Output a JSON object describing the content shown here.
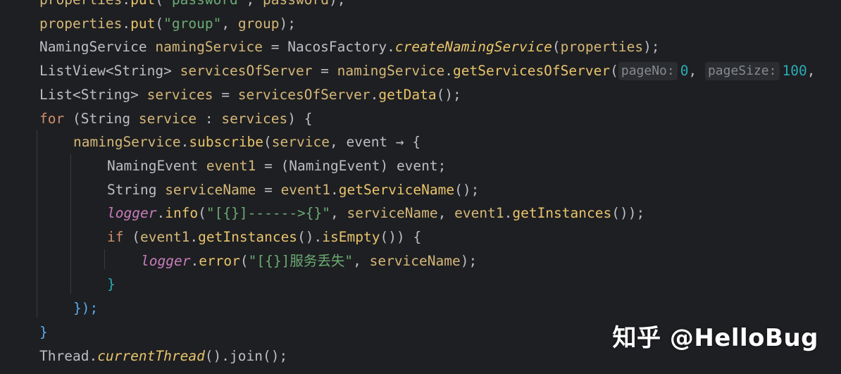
{
  "colors": {
    "background": "#1e1f22",
    "plain": "#bcbec4",
    "method": "#57aaf7",
    "field": "#c77dbb",
    "local": "#d5b778",
    "string": "#6aab73",
    "keyword": "#cf8e6d",
    "static": "#e8c46c",
    "number": "#2aacb8",
    "hint": "#868a91"
  },
  "code_lines": [
    {
      "tokens": [
        {
          "t": "properties",
          "c": "local"
        },
        {
          "t": ".",
          "c": "plain"
        },
        {
          "t": "put",
          "c": "static"
        },
        {
          "t": "(",
          "c": "plain"
        },
        {
          "t": "\"password\"",
          "c": "string"
        },
        {
          "t": ", ",
          "c": "plain"
        },
        {
          "t": "password",
          "c": "local"
        },
        {
          "t": ");",
          "c": "plain"
        }
      ]
    },
    {
      "tokens": [
        {
          "t": "properties",
          "c": "local"
        },
        {
          "t": ".",
          "c": "plain"
        },
        {
          "t": "put",
          "c": "static"
        },
        {
          "t": "(",
          "c": "plain"
        },
        {
          "t": "\"group\"",
          "c": "string"
        },
        {
          "t": ", ",
          "c": "plain"
        },
        {
          "t": "group",
          "c": "local"
        },
        {
          "t": ");",
          "c": "plain"
        }
      ]
    },
    {
      "tokens": [
        {
          "t": "NamingService ",
          "c": "plain"
        },
        {
          "t": "namingService",
          "c": "local"
        },
        {
          "t": " = NacosFactory.",
          "c": "plain"
        },
        {
          "t": "createNamingService",
          "c": "static_italic"
        },
        {
          "t": "(",
          "c": "plain"
        },
        {
          "t": "properties",
          "c": "local"
        },
        {
          "t": ");",
          "c": "plain"
        }
      ]
    },
    {
      "tokens": [
        {
          "t": "ListView<String> ",
          "c": "plain"
        },
        {
          "t": "servicesOfServer",
          "c": "local"
        },
        {
          "t": " = ",
          "c": "plain"
        },
        {
          "t": "namingService",
          "c": "local"
        },
        {
          "t": ".",
          "c": "plain"
        },
        {
          "t": "getServicesOfServer",
          "c": "static"
        },
        {
          "t": "(",
          "c": "plain"
        },
        {
          "t": "pageNo:",
          "c": "hint"
        },
        {
          "t": "0",
          "c": "number"
        },
        {
          "t": ", ",
          "c": "plain"
        },
        {
          "t": "pageSize:",
          "c": "hint"
        },
        {
          "t": "100",
          "c": "number"
        },
        {
          "t": ",",
          "c": "plain"
        }
      ]
    },
    {
      "tokens": [
        {
          "t": "List<String> ",
          "c": "plain"
        },
        {
          "t": "services",
          "c": "local"
        },
        {
          "t": " = ",
          "c": "plain"
        },
        {
          "t": "servicesOfServer",
          "c": "local"
        },
        {
          "t": ".",
          "c": "plain"
        },
        {
          "t": "getData",
          "c": "static"
        },
        {
          "t": "();",
          "c": "plain"
        }
      ]
    },
    {
      "tokens": [
        {
          "t": "for",
          "c": "keyword"
        },
        {
          "t": " (String ",
          "c": "plain"
        },
        {
          "t": "service",
          "c": "local"
        },
        {
          "t": " : ",
          "c": "plain"
        },
        {
          "t": "services",
          "c": "local"
        },
        {
          "t": ") {",
          "c": "plain"
        }
      ]
    },
    {
      "indent": 1,
      "tokens": [
        {
          "t": "namingService",
          "c": "local"
        },
        {
          "t": ".",
          "c": "plain"
        },
        {
          "t": "subscribe",
          "c": "static"
        },
        {
          "t": "(",
          "c": "plain"
        },
        {
          "t": "service",
          "c": "local"
        },
        {
          "t": ", ",
          "c": "plain"
        },
        {
          "t": "event",
          "c": "plain"
        },
        {
          "t": " → {",
          "c": "plain"
        }
      ]
    },
    {
      "indent": 2,
      "tokens": [
        {
          "t": "NamingEvent ",
          "c": "plain"
        },
        {
          "t": "event1",
          "c": "local"
        },
        {
          "t": " = (NamingEvent) ",
          "c": "plain"
        },
        {
          "t": "event",
          "c": "plain"
        },
        {
          "t": ";",
          "c": "plain"
        }
      ]
    },
    {
      "indent": 2,
      "tokens": [
        {
          "t": "String ",
          "c": "plain"
        },
        {
          "t": "serviceName",
          "c": "local"
        },
        {
          "t": " = ",
          "c": "plain"
        },
        {
          "t": "event1",
          "c": "local"
        },
        {
          "t": ".",
          "c": "plain"
        },
        {
          "t": "getServiceName",
          "c": "static"
        },
        {
          "t": "();",
          "c": "plain"
        }
      ]
    },
    {
      "indent": 2,
      "tokens": [
        {
          "t": "logger",
          "c": "field_italic"
        },
        {
          "t": ".",
          "c": "plain"
        },
        {
          "t": "info",
          "c": "static"
        },
        {
          "t": "(",
          "c": "plain"
        },
        {
          "t": "\"[{}]------>{}\"",
          "c": "string"
        },
        {
          "t": ", ",
          "c": "plain"
        },
        {
          "t": "serviceName",
          "c": "local"
        },
        {
          "t": ", ",
          "c": "plain"
        },
        {
          "t": "event1",
          "c": "local"
        },
        {
          "t": ".",
          "c": "plain"
        },
        {
          "t": "getInstances",
          "c": "static"
        },
        {
          "t": "());",
          "c": "plain"
        }
      ]
    },
    {
      "indent": 2,
      "tokens": [
        {
          "t": "if",
          "c": "keyword"
        },
        {
          "t": " (",
          "c": "plain"
        },
        {
          "t": "event1",
          "c": "local"
        },
        {
          "t": ".",
          "c": "plain"
        },
        {
          "t": "getInstances",
          "c": "static"
        },
        {
          "t": "().",
          "c": "plain"
        },
        {
          "t": "isEmpty",
          "c": "static"
        },
        {
          "t": "()) {",
          "c": "plain"
        }
      ]
    },
    {
      "indent": 3,
      "tokens": [
        {
          "t": "logger",
          "c": "field_italic"
        },
        {
          "t": ".",
          "c": "plain"
        },
        {
          "t": "error",
          "c": "static"
        },
        {
          "t": "(",
          "c": "plain"
        },
        {
          "t": "\"[{}]服务丢失\"",
          "c": "string"
        },
        {
          "t": ", ",
          "c": "plain"
        },
        {
          "t": "serviceName",
          "c": "local"
        },
        {
          "t": ");",
          "c": "plain"
        }
      ]
    },
    {
      "indent": 2,
      "tokens": [
        {
          "t": "}",
          "c": "number"
        }
      ]
    },
    {
      "indent": 1,
      "tokens": [
        {
          "t": "});",
          "c": "method"
        }
      ]
    },
    {
      "tokens": [
        {
          "t": "}",
          "c": "method"
        }
      ]
    },
    {
      "tokens": [
        {
          "t": "Thread.",
          "c": "plain"
        },
        {
          "t": "currentThread",
          "c": "static_italic"
        },
        {
          "t": "().join();",
          "c": "plain"
        }
      ]
    }
  ],
  "watermark": {
    "text": "知乎 @HelloBug"
  }
}
